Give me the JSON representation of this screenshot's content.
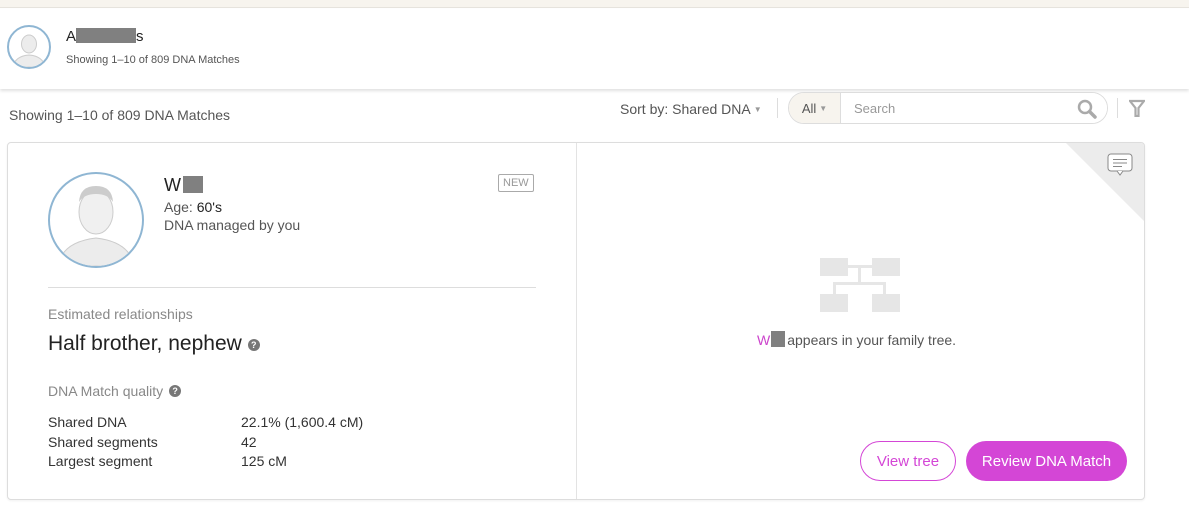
{
  "header": {
    "name_first": "A",
    "name_last": "s",
    "subtitle": "Showing 1–10 of 809 DNA Matches"
  },
  "toolbar": {
    "showing": "Showing 1–10 of 809 DNA Matches",
    "sort_label": "Sort by: Shared DNA",
    "filter_scope": "All",
    "search_placeholder": "Search"
  },
  "match": {
    "name_initial": "W",
    "age_label": "Age:",
    "age_value": "60's",
    "managed": "DNA managed by you",
    "badge": "NEW",
    "est_label": "Estimated relationships",
    "relationship": "Half brother, nephew",
    "quality_label": "DNA Match quality",
    "stats": [
      {
        "label": "Shared DNA",
        "value": "22.1% (1,600.4 cM)"
      },
      {
        "label": "Shared segments",
        "value": "42"
      },
      {
        "label": "Largest segment",
        "value": "125 cM"
      }
    ],
    "tree_name": "W",
    "tree_text": "appears in your family tree.",
    "view_tree": "View tree",
    "review": "Review DNA Match"
  },
  "colors": {
    "accent": "#d446d6",
    "avatar_ring": "#8fb6d3"
  }
}
